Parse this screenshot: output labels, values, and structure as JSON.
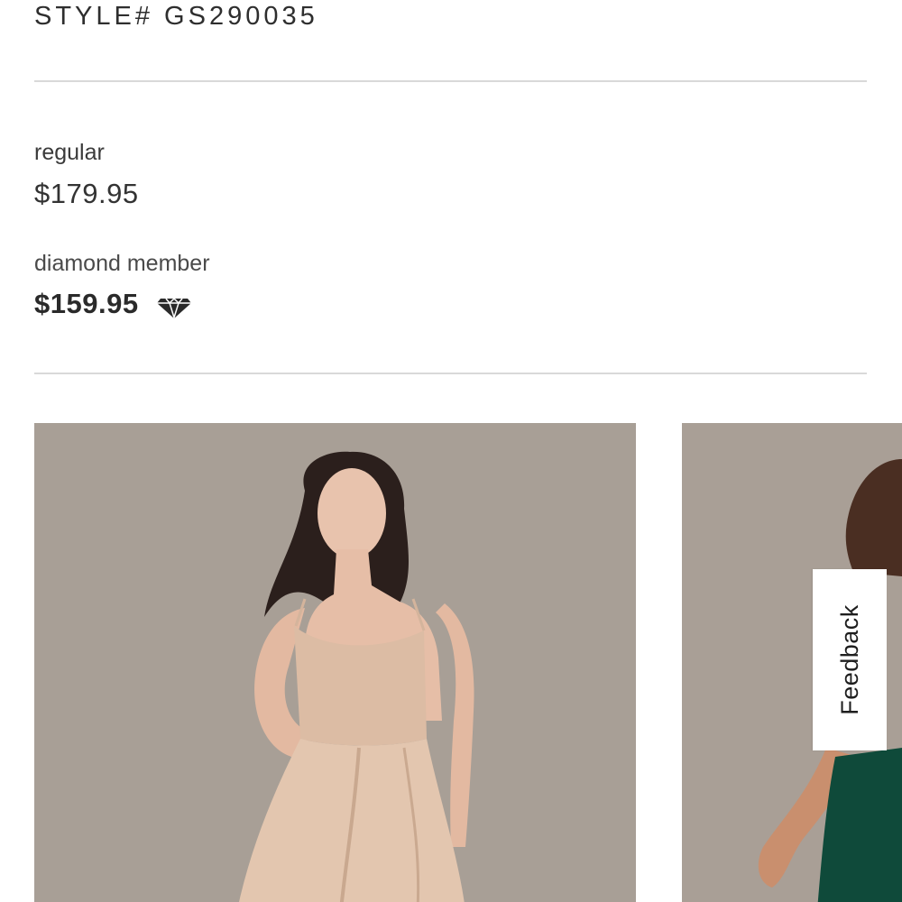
{
  "product": {
    "style_number": "STYLE# GS290035"
  },
  "pricing": {
    "regular_label": "regular",
    "regular_price": "$179.95",
    "member_label": "diamond member",
    "member_price": "$159.95",
    "member_icon": "diamond-icon"
  },
  "gallery": {
    "images": [
      {
        "subject": "champagne-satin-dress",
        "color": "#d8b9a0"
      },
      {
        "subject": "green-satin-dress",
        "color": "#0f4a3a"
      }
    ],
    "backdrop_color": "#a79e95"
  },
  "feedback": {
    "label": "Feedback"
  }
}
